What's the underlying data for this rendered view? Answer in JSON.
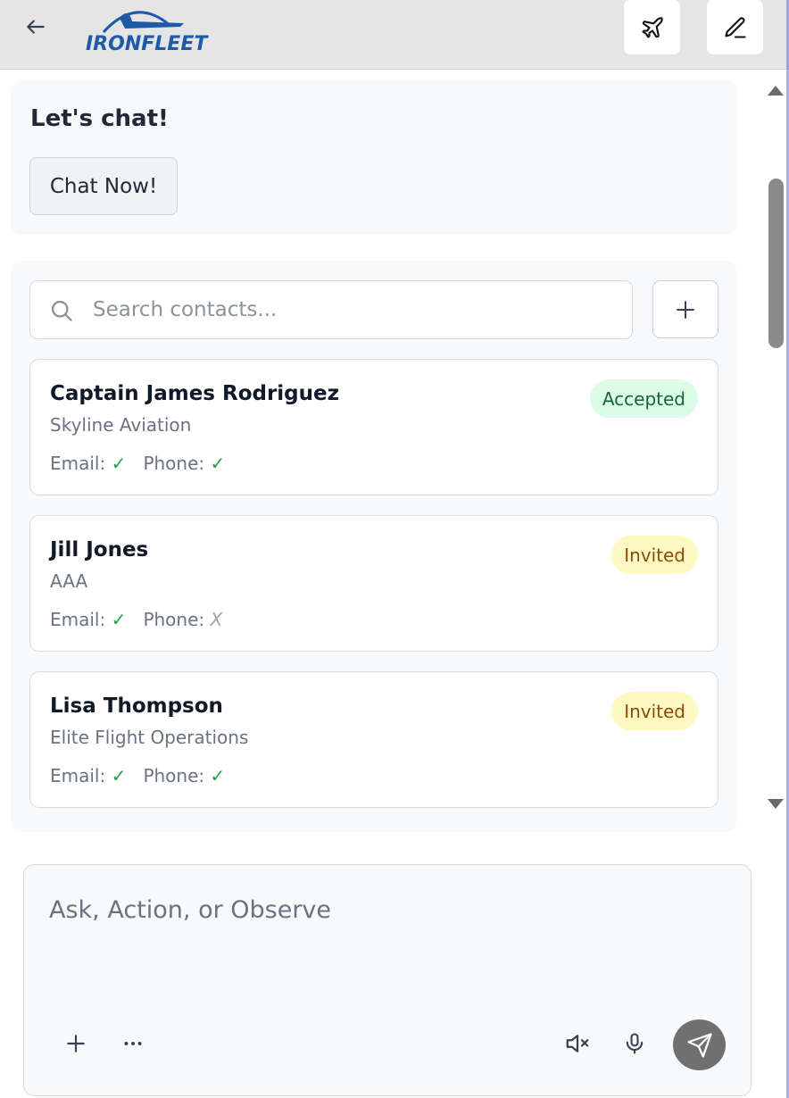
{
  "header": {
    "logo_text": "IRONFLEET",
    "back_icon": "arrow-left-icon",
    "plane_icon": "plane-icon",
    "edit_icon": "pencil-icon"
  },
  "chat_card": {
    "title": "Let's chat!",
    "button_label": "Chat Now!"
  },
  "contacts": {
    "search_placeholder": "Search contacts...",
    "add_icon": "plus-icon",
    "items": [
      {
        "name": "Captain James Rodriguez",
        "org": "Skyline Aviation",
        "email_label": "Email:",
        "email_mark": "✓",
        "phone_label": "Phone:",
        "phone_mark": "✓",
        "badge": "Accepted"
      },
      {
        "name": "Jill Jones",
        "org": "AAA",
        "email_label": "Email:",
        "email_mark": "✓",
        "phone_label": "Phone:",
        "phone_mark": "X",
        "badge": "Invited"
      },
      {
        "name": "Lisa Thompson",
        "org": "Elite Flight Operations",
        "email_label": "Email:",
        "email_mark": "✓",
        "phone_label": "Phone:",
        "phone_mark": "✓",
        "badge": "Invited"
      }
    ]
  },
  "composer": {
    "placeholder": "Ask, Action, or Observe",
    "icons": [
      "plus-icon",
      "more-dots-icon",
      "speaker-muted-icon",
      "microphone-icon",
      "send-icon"
    ]
  },
  "colors": {
    "accent_blue": "#1e5aa8",
    "accepted_bg": "#dcfce7",
    "invited_bg": "#fef9c3",
    "check_green": "#22a04a"
  }
}
